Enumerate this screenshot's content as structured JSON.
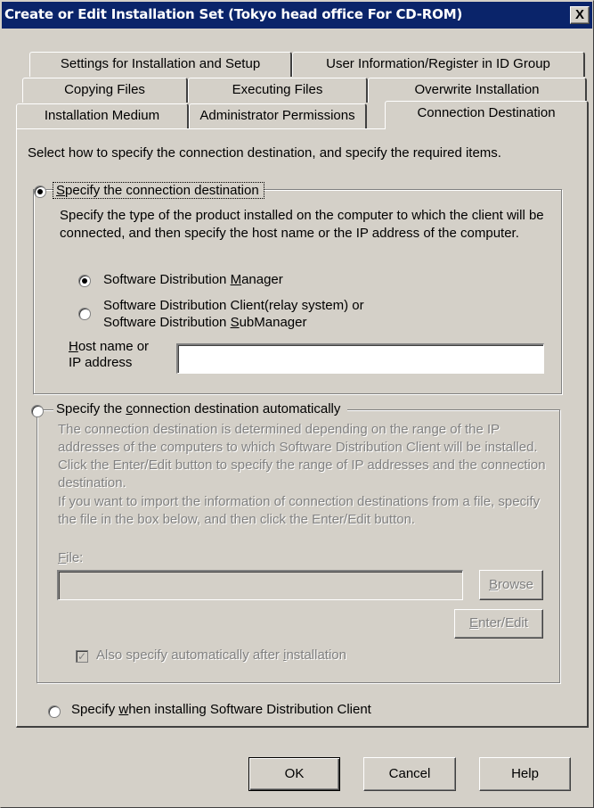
{
  "window": {
    "title": "Create or Edit Installation Set (Tokyo head office For CD-ROM)",
    "close_glyph": "X"
  },
  "tabs": {
    "row1": [
      "Settings for Installation and Setup",
      "User Information/Register in ID Group"
    ],
    "row2": [
      "Copying Files",
      "Executing Files",
      "Overwrite Installation"
    ],
    "row3": [
      "Installation Medium",
      "Administrator Permissions",
      "Connection Destination"
    ],
    "active": "Connection Destination"
  },
  "intro": "Select how to specify the connection destination, and specify the required items.",
  "option_manual": {
    "label_pre": "",
    "label_key": "S",
    "label_post": "pecify the connection destination",
    "selected": true,
    "description": "Specify the type of the product installed on the computer to which the client will be connected, and then specify the host name or the IP address of the computer.",
    "manager": {
      "label_pre": "Software Distribution ",
      "label_key": "M",
      "label_post": "anager",
      "selected": true
    },
    "client": {
      "line1": "Software Distribution Client(relay system) or",
      "line2_pre": "Software Distribution ",
      "line2_key": "S",
      "line2_post": "ubManager",
      "selected": false
    },
    "host_label_pre": "",
    "host_label_key": "H",
    "host_label_post": "ost name or",
    "host_label_line2": "IP address",
    "host_value": ""
  },
  "option_auto": {
    "label_pre": "Specify the ",
    "label_key": "c",
    "label_post": "onnection destination automatically",
    "selected": false,
    "description1": "The connection destination is determined depending on the range of the IP addresses of the computers to which Software Distribution Client will be installed. Click the Enter/Edit button to specify the range of IP addresses and the connection destination.",
    "description2": "If you want to import the information of connection destinations from a file, specify the file in the box below, and then click the Enter/Edit button.",
    "file_label_key": "F",
    "file_label_post": "ile:",
    "file_value": "",
    "browse_key": "B",
    "browse_post": "rowse",
    "enter_key": "E",
    "enter_post": "nter/Edit",
    "also_pre": "Also specify automatically after ",
    "also_key": "i",
    "also_post": "nstallation",
    "also_checked": true
  },
  "option_install": {
    "label_pre": "Specify ",
    "label_key": "w",
    "label_post": "hen installing Software Distribution Client",
    "selected": false
  },
  "buttons": {
    "ok": "OK",
    "cancel": "Cancel",
    "help": "Help"
  },
  "colors": {
    "titlebar": "#0a246a",
    "face": "#d4d0c8",
    "disabled_text": "#808080"
  }
}
